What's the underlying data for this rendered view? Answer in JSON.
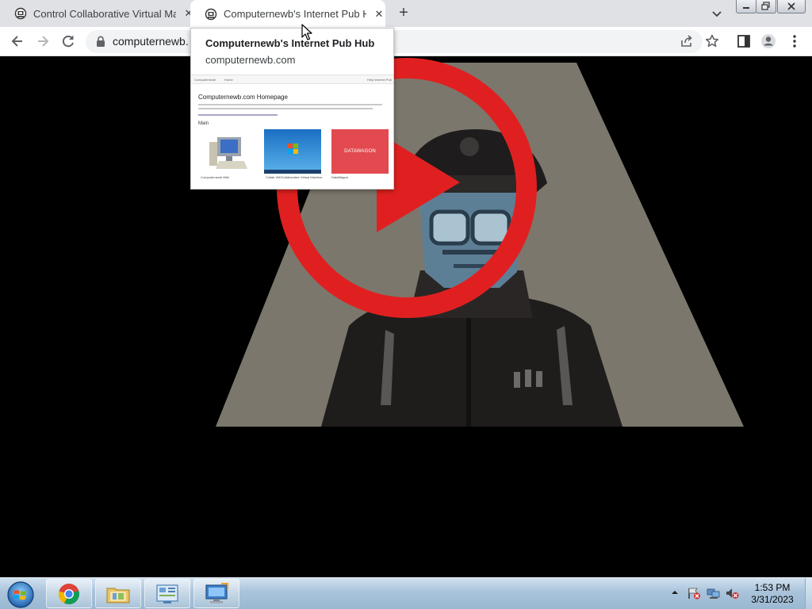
{
  "browser": {
    "tabs": [
      {
        "title": "Control Collaborative Virtual Mac",
        "favicon": "computernewb-favicon",
        "active": false
      },
      {
        "title": "Computernewb's Internet Pub Hu",
        "favicon": "computernewb-favicon",
        "active": true
      }
    ],
    "new_tab_label": "+",
    "close_glyph": "✕",
    "url": "computernewb."
  },
  "hovercard": {
    "title": "Computernewb's Internet Pub Hub",
    "domain": "computernewb.com",
    "preview": {
      "nav_left": "Computernewb",
      "nav_mid": "Home",
      "nav_right": "Help Internet Pub",
      "heading": "Computernewb.com Homepage",
      "section": "Main",
      "cards": [
        {
          "caption": "Computernewb Wiki"
        },
        {
          "caption": "Collab VM/Collaborative Virtual Machine"
        },
        {
          "caption": "DataWagon",
          "banner": "DATAWAGON"
        }
      ]
    }
  },
  "video": {
    "play_button_color": "#e02020",
    "figure": "pixel-art officer portrait"
  },
  "taskbar": {
    "apps": [
      "chrome",
      "file-explorer",
      "control-panel",
      "remote-desktop"
    ],
    "clock_time": "1:53 PM",
    "clock_date": "3/31/2023"
  },
  "colors": {
    "tabstrip": "#dfe1e5",
    "accent_red": "#e02020",
    "spotlight": "#7a766c"
  }
}
